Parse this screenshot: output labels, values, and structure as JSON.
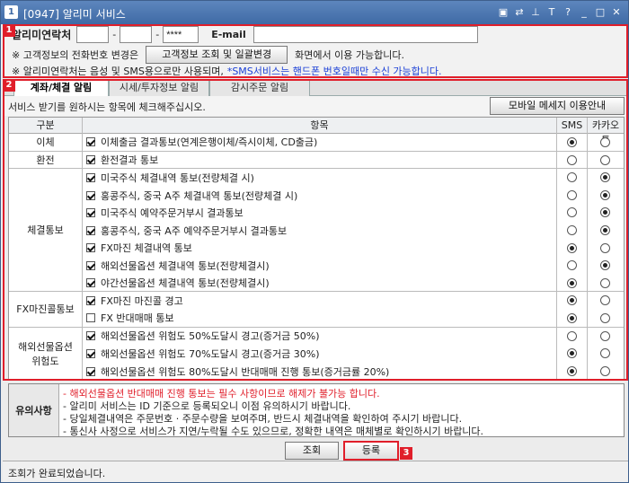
{
  "window": {
    "title": "[0947] 알리미 서비스",
    "icon": "1"
  },
  "titlebar_buttons": [
    "▣",
    "⇄",
    "⊥",
    "T",
    "?",
    "_",
    "□",
    "✕"
  ],
  "badges": {
    "one": "1",
    "two": "2",
    "three": "3"
  },
  "contact": {
    "label": "알리미연락처",
    "phone1": "",
    "phone2": "",
    "phone3": "****",
    "dash1": "-",
    "dash2": "-",
    "email_label": "E-mail",
    "email": "",
    "note1_prefix": "※ 고객정보의 전화번호 변경은",
    "lookup_button": "고객정보 조회 및 일괄변경",
    "note1_suffix": "화면에서 이용 가능합니다.",
    "note2_prefix": "※ 알리미연락처는 음성 및 SMS용으로만 사용되며,",
    "note2_blue": "*SMS서비스는 핸드폰 번호일때만 수신 가능합니다."
  },
  "tabs": [
    "계좌/체결 알림",
    "시세/투자정보 알림",
    "감시주문 알림"
  ],
  "guide_text": "서비스 받기를 원하시는 항목에 체크해주십시오.",
  "mobile_button": "모바일 메세지 이용안내",
  "table": {
    "headers": [
      "구분",
      "항목",
      "SMS",
      "카카오톡"
    ],
    "categories": [
      "이체",
      "환전",
      "체결통보",
      "FX마진콜통보",
      "해외선물옵션\n위험도"
    ],
    "rows": [
      {
        "label": "이체출금 결과통보(연계은행이체/즉시이체, CD출금)",
        "checked": true,
        "sms": true,
        "kakao": false
      },
      {
        "label": "환전결과 통보",
        "checked": true,
        "sms": false,
        "kakao": false
      },
      {
        "label": "미국주식 체결내역 통보(전량체결 시)",
        "checked": true,
        "sms": false,
        "kakao": true
      },
      {
        "label": "홍콩주식, 중국 A주 체결내역 통보(전량체결 시)",
        "checked": true,
        "sms": false,
        "kakao": true
      },
      {
        "label": "미국주식 예약주문거부시 결과통보",
        "checked": true,
        "sms": false,
        "kakao": true
      },
      {
        "label": "홍콩주식, 중국 A주 예약주문거부시 결과통보",
        "checked": true,
        "sms": false,
        "kakao": true
      },
      {
        "label": "FX마진 체결내역 통보",
        "checked": true,
        "sms": true,
        "kakao": false
      },
      {
        "label": "해외선물옵션 체결내역 통보(전량체결시)",
        "checked": true,
        "sms": false,
        "kakao": true
      },
      {
        "label": "야간선물옵션 체결내역 통보(전량체결시)",
        "checked": true,
        "sms": true,
        "kakao": false
      },
      {
        "label": "FX마진 마진콜 경고",
        "checked": true,
        "sms": true,
        "kakao": false
      },
      {
        "label": "FX 반대매매 통보",
        "checked": false,
        "sms": true,
        "kakao": false
      },
      {
        "label": "해외선물옵션 위험도 50%도달시 경고(증거금 50%)",
        "checked": true,
        "sms": false,
        "kakao": false
      },
      {
        "label": "해외선물옵션 위험도 70%도달시 경고(증거금 30%)",
        "checked": true,
        "sms": true,
        "kakao": false
      },
      {
        "label": "해외선물옵션 위험도 80%도달시 반대매매 진행 통보(증거금률 20%)",
        "checked": true,
        "sms": true,
        "kakao": false
      }
    ]
  },
  "notice": {
    "label": "유의사항",
    "lines": [
      "- 해외선물옵션 반대매매 진행 통보는 필수 사항이므로 해제가 불가능 합니다.",
      "- 알리미 서비스는 ID 기준으로 등록되오니 이점 유의하시기 바랍니다.",
      "- 당일체결내역은 주문번호 · 주문수량을 보여주며, 반드시 체결내역을 확인하여 주시기 바랍니다.",
      "- 통신사 사정으로 서비스가 지연/누락될 수도 있으므로, 정확한 내역은 매체별로 확인하시기 바랍니다."
    ],
    "first_line_color": "#e01e2a"
  },
  "buttons": {
    "lookup": "조회",
    "register": "등록"
  },
  "status": "조회가 완료되었습니다.",
  "colors": {
    "highlight": "#e01e2a",
    "titlebar": "#4a76b0",
    "blue_text": "#1a3fd6"
  }
}
